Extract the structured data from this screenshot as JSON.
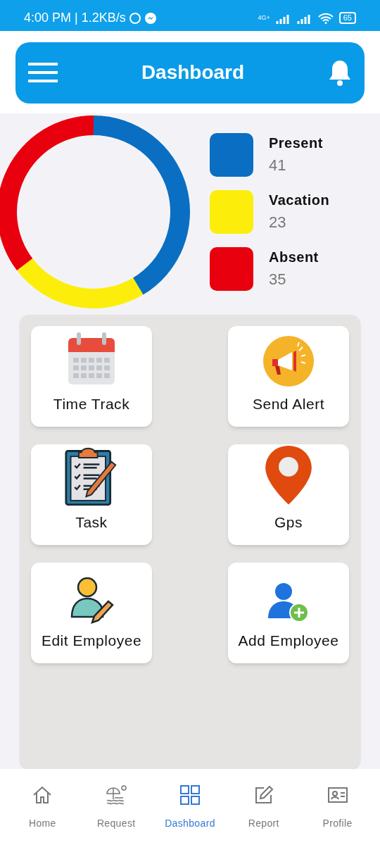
{
  "status_bar": {
    "time": "4:00 PM | 1.2KB/s",
    "network": "4G+",
    "battery": "65"
  },
  "header": {
    "title": "Dashboard"
  },
  "attendance": {
    "chart_data": {
      "type": "donut",
      "categories": [
        "Present",
        "Vacation",
        "Absent"
      ],
      "values": [
        41,
        23,
        35
      ]
    },
    "legend": [
      {
        "count": "41",
        "color": "#0a6fc2"
      },
      {
        "count": "23",
        "color": "#fcee0a"
      },
      {
        "count": "35",
        "color": "#e8000e"
      }
    ]
  },
  "tiles": [
    {
      "label": "Time Track",
      "kind": "calendar"
    },
    {
      "label": "Send Alert",
      "kind": "megaphone"
    },
    {
      "label": "Task",
      "kind": "clipboard"
    },
    {
      "label": "Gps",
      "kind": "pin"
    },
    {
      "label": "Edit Employee",
      "kind": "edit-user"
    },
    {
      "label": "Add Employee",
      "kind": "add-user"
    }
  ],
  "bottom_nav": [
    {
      "label": "Home",
      "kind": "home",
      "selected": false
    },
    {
      "label": "Request",
      "kind": "beach",
      "selected": false
    },
    {
      "label": "Dashboard",
      "kind": "grid",
      "selected": true
    },
    {
      "label": "Report",
      "kind": "edit",
      "selected": false
    },
    {
      "label": "Profile",
      "kind": "card",
      "selected": false
    }
  ]
}
